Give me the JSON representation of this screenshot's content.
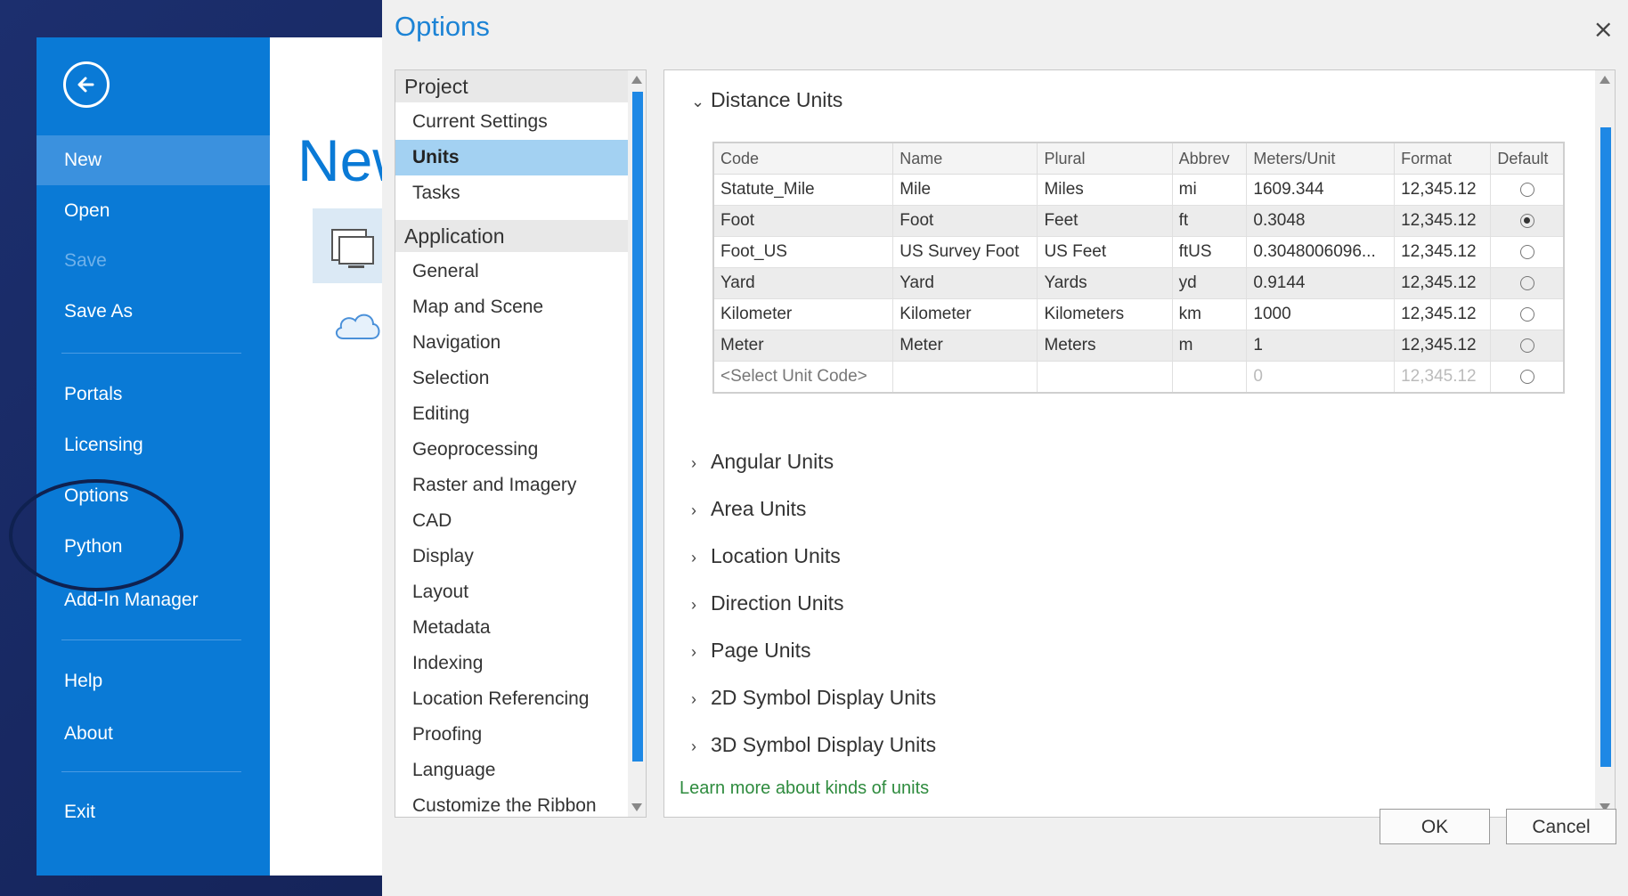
{
  "backstage": {
    "items": [
      {
        "label": "New",
        "selected": true
      },
      {
        "label": "Open"
      },
      {
        "label": "Save",
        "disabled": true
      },
      {
        "label": "Save As"
      },
      {
        "label": "Portals"
      },
      {
        "label": "Licensing"
      },
      {
        "label": "Options"
      },
      {
        "label": "Python"
      },
      {
        "label": "Add-In Manager"
      },
      {
        "label": "Help"
      },
      {
        "label": "About"
      },
      {
        "label": "Exit"
      }
    ],
    "page_title": "New"
  },
  "dialog": {
    "title": "Options",
    "close_glyph": "×",
    "nav": {
      "groups": [
        {
          "label": "Project",
          "items": [
            "Current Settings",
            "Units",
            "Tasks"
          ]
        },
        {
          "label": "Application",
          "items": [
            "General",
            "Map and Scene",
            "Navigation",
            "Selection",
            "Editing",
            "Geoprocessing",
            "Raster and Imagery",
            "CAD",
            "Display",
            "Layout",
            "Metadata",
            "Indexing",
            "Location Referencing",
            "Proofing",
            "Language",
            "Customize the Ribbon"
          ]
        }
      ],
      "selected": "Units"
    },
    "distance_units": {
      "header": "Distance Units",
      "columns": [
        "Code",
        "Name",
        "Plural",
        "Abbrev",
        "Meters/Unit",
        "Format",
        "Default"
      ],
      "rows": [
        {
          "code": "Statute_Mile",
          "name": "Mile",
          "plural": "Miles",
          "abbrev": "mi",
          "meters": "1609.344",
          "format": "12,345.12",
          "default": false
        },
        {
          "code": "Foot",
          "name": "Foot",
          "plural": "Feet",
          "abbrev": "ft",
          "meters": "0.3048",
          "format": "12,345.12",
          "default": true
        },
        {
          "code": "Foot_US",
          "name": "US Survey Foot",
          "plural": "US Feet",
          "abbrev": "ftUS",
          "meters": "0.3048006096...",
          "format": "12,345.12",
          "default": false
        },
        {
          "code": "Yard",
          "name": "Yard",
          "plural": "Yards",
          "abbrev": "yd",
          "meters": "0.9144",
          "format": "12,345.12",
          "default": false
        },
        {
          "code": "Kilometer",
          "name": "Kilometer",
          "plural": "Kilometers",
          "abbrev": "km",
          "meters": "1000",
          "format": "12,345.12",
          "default": false
        },
        {
          "code": "Meter",
          "name": "Meter",
          "plural": "Meters",
          "abbrev": "m",
          "meters": "1",
          "format": "12,345.12",
          "default": false
        }
      ],
      "placeholder_row": {
        "code": "<Select Unit Code>",
        "meters": "0",
        "format": "12,345.12"
      }
    },
    "collapsed_sections": [
      "Angular Units",
      "Area Units",
      "Location Units",
      "Direction Units",
      "Page Units",
      "2D Symbol Display Units",
      "3D Symbol Display Units"
    ],
    "learn_more": "Learn more about kinds of units",
    "ok_label": "OK",
    "cancel_label": "Cancel"
  },
  "colors": {
    "backstage_blue": "#0a7ad6",
    "selected_nav": "#a3d1f2",
    "scrollbar": "#1e88e5",
    "link_green": "#2e8b3e"
  }
}
